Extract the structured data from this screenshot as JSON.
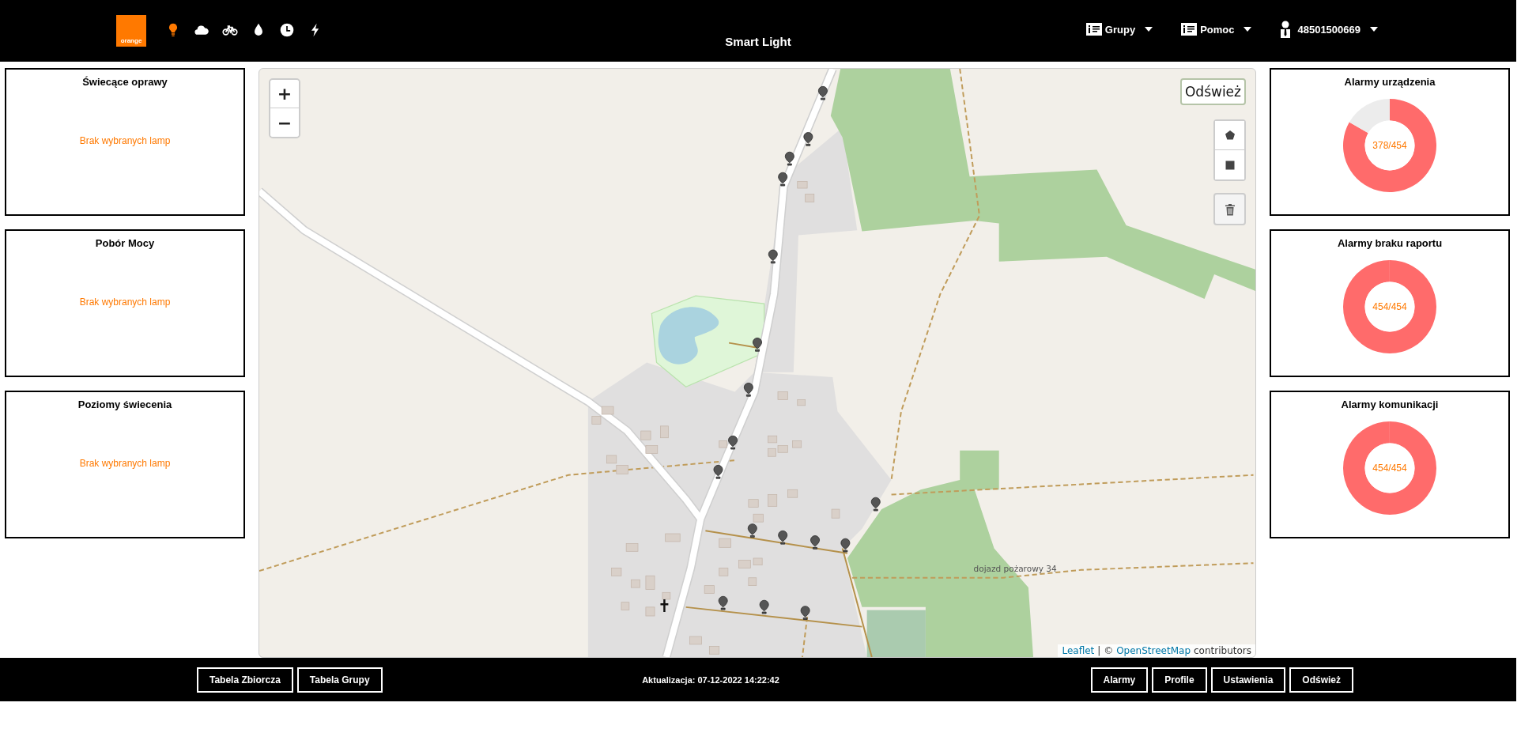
{
  "header": {
    "logo": "orange",
    "title": "Smart Light",
    "icons": [
      {
        "kind": "bulb",
        "selected": true
      },
      {
        "kind": "cloud",
        "selected": false
      },
      {
        "kind": "bike",
        "selected": false
      },
      {
        "kind": "drop",
        "selected": false
      },
      {
        "kind": "clock",
        "selected": false
      },
      {
        "kind": "bolt",
        "selected": false
      }
    ],
    "menus": [
      {
        "kind": "info",
        "label": "Grupy"
      },
      {
        "kind": "info",
        "label": "Pomoc"
      },
      {
        "kind": "user",
        "label": "48501500669"
      }
    ]
  },
  "left_panels": [
    {
      "title": "Świecące oprawy",
      "message": "Brak wybranych lamp"
    },
    {
      "title": "Pobór Mocy",
      "message": "Brak wybranych lamp"
    },
    {
      "title": "Poziomy świecenia",
      "message": "Brak wybranych lamp"
    }
  ],
  "map": {
    "refresh_button": "Odśwież",
    "zoom_in": "+",
    "zoom_out": "−",
    "road_label": "dojazd pożarowy 34",
    "attribution": {
      "link1": "Leaflet",
      "separator": "| ©",
      "link2": "OpenStreetMap",
      "suffix": "contributors"
    }
  },
  "right_panels": [
    {
      "title": "Alarmy urządzenia",
      "label": "378/454",
      "chart_data": {
        "type": "donut",
        "values": [
          83.3,
          16.7
        ]
      }
    },
    {
      "title": "Alarmy braku raportu",
      "label": "454/454",
      "chart_data": {
        "type": "donut",
        "values": [
          100
        ]
      }
    },
    {
      "title": "Alarmy komunikacji",
      "label": "454/454",
      "chart_data": {
        "type": "donut",
        "values": [
          100
        ]
      }
    }
  ],
  "footer": {
    "left_buttons": [
      "Tabela Zbiorcza",
      "Tabela Grupy"
    ],
    "update": "Aktualizacja: 07-12-2022 14:22:42",
    "right_buttons": [
      "Alarmy",
      "Profile",
      "Ustawienia",
      "Odśwież"
    ]
  }
}
